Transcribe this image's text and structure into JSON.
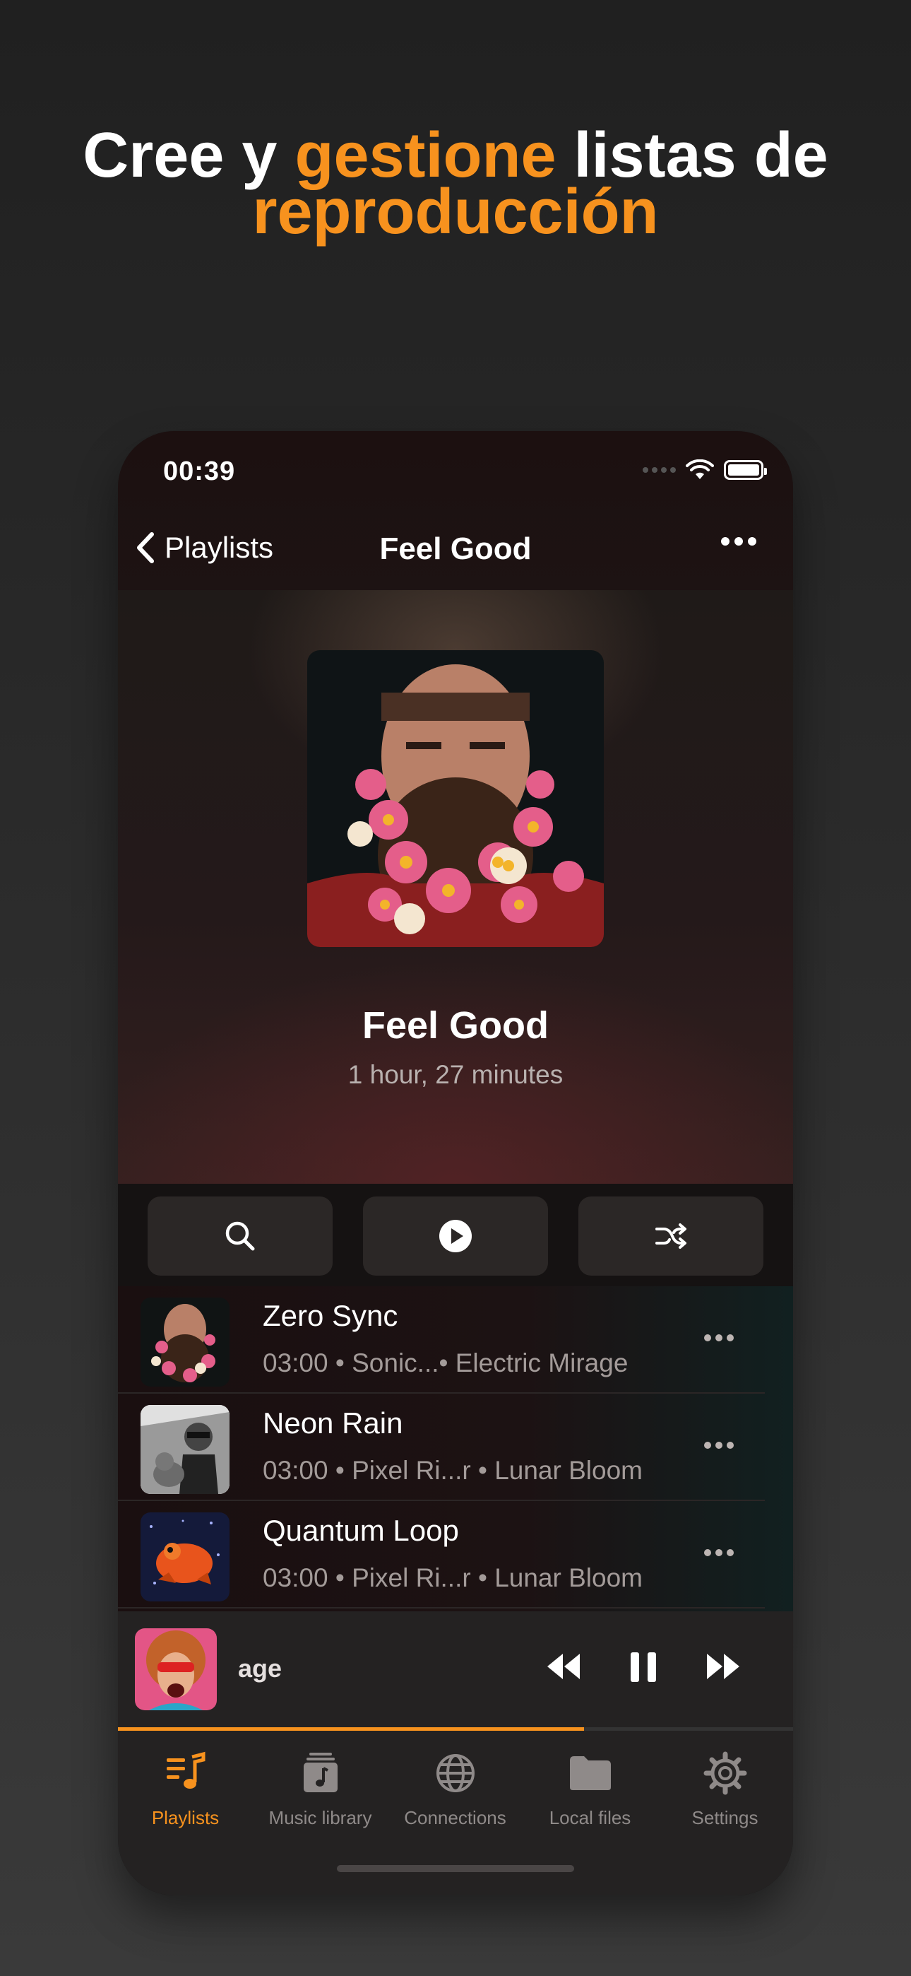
{
  "headline": {
    "line1_a": "Cree y ",
    "line1_accent": "gestione",
    "line1_b": " listas de",
    "line2_accent": "reproducción"
  },
  "status_bar": {
    "time": "00:39"
  },
  "nav": {
    "back_label": "Playlists",
    "title": "Feel Good",
    "more_icon": "more-horizontal-icon"
  },
  "playlist": {
    "title": "Feel Good",
    "duration": "1 hour, 27 minutes"
  },
  "actions": [
    {
      "name": "search",
      "icon": "search-icon"
    },
    {
      "name": "play",
      "icon": "play-circle-icon"
    },
    {
      "name": "shuffle",
      "icon": "shuffle-icon"
    }
  ],
  "tracks": [
    {
      "title": "Zero Sync",
      "meta": "03:00 • Sonic...• Electric Mirage"
    },
    {
      "title": "Neon Rain",
      "meta": "03:00 • Pixel Ri...r • Lunar Bloom"
    },
    {
      "title": "Quantum Loop",
      "meta": "03:00 • Pixel Ri...r • Lunar Bloom"
    }
  ],
  "now_playing": {
    "title_fragment": "age",
    "progress": 0.69
  },
  "tabs": [
    {
      "label": "Playlists",
      "icon": "playlist-music-icon",
      "active": true
    },
    {
      "label": "Music library",
      "icon": "music-library-icon",
      "active": false
    },
    {
      "label": "Connections",
      "icon": "globe-icon",
      "active": false
    },
    {
      "label": "Local files",
      "icon": "folder-icon",
      "active": false
    },
    {
      "label": "Settings",
      "icon": "gear-icon",
      "active": false
    }
  ],
  "colors": {
    "accent": "#f7921e",
    "background": "#2a2a2a",
    "panel": "#242222"
  }
}
